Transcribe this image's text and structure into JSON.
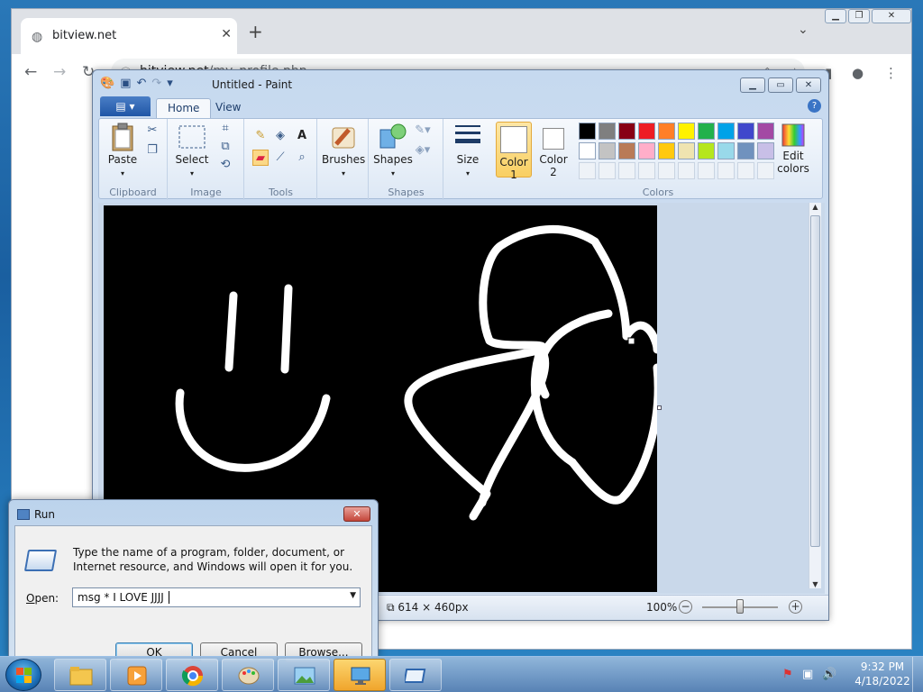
{
  "browser": {
    "tab_title": "bitview.net",
    "url_host": "bitview.net",
    "url_path": "/my_profile.php"
  },
  "paint": {
    "window_title": "Untitled - Paint",
    "tabs": [
      "Home",
      "View"
    ],
    "groups": {
      "clipboard": "Clipboard",
      "image": "Image",
      "tools": "Tools",
      "shapes": "Shapes",
      "colors": "Colors"
    },
    "buttons": {
      "paste": "Paste",
      "select": "Select",
      "brushes": "Brushes",
      "shapes": "Shapes",
      "size": "Size",
      "color1_a": "Color",
      "color1_b": "1",
      "color2_a": "Color",
      "color2_b": "2",
      "edit_colors_a": "Edit",
      "edit_colors_b": "colors"
    },
    "palette_row1": [
      "#000000",
      "#7f7f7f",
      "#880015",
      "#ed1c24",
      "#ff7f27",
      "#fff200",
      "#22b14c",
      "#00a2e8",
      "#3f48cc",
      "#a349a4"
    ],
    "palette_row2": [
      "#ffffff",
      "#c3c3c3",
      "#b97a57",
      "#ffaec9",
      "#ffc90e",
      "#efe4b0",
      "#b5e61d",
      "#99d9ea",
      "#7092be",
      "#c8bfe7"
    ],
    "canvas_size": "614 × 460px",
    "zoom": "100%",
    "zoom_slider_level": 0.5
  },
  "run": {
    "title": "Run",
    "description": "Type the name of a program, folder, document, or Internet resource, and Windows will open it for you.",
    "open_label_prefix": "",
    "open_label_underlined": "O",
    "open_label_rest": "pen:",
    "input_value": "msg * I LOVE JJJJ ",
    "buttons": {
      "ok": "OK",
      "cancel": "Cancel",
      "browse": "Browse..."
    }
  },
  "taskbar": {
    "time": "9:32 PM",
    "date": "4/18/2022"
  }
}
